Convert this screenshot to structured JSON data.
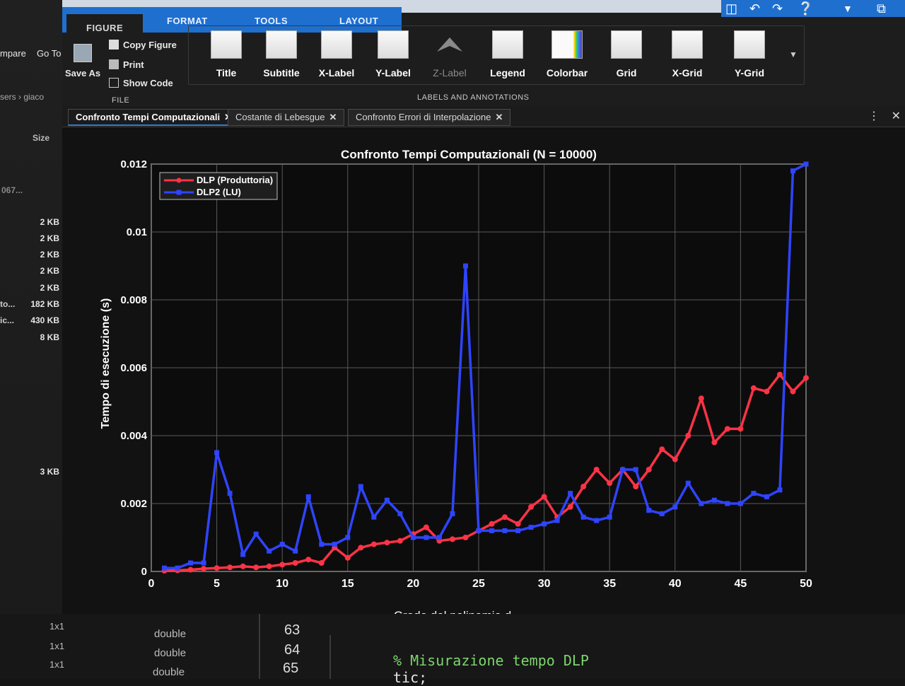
{
  "ribbon": {
    "tabs": [
      "FIGURE",
      "FORMAT",
      "TOOLS",
      "LAYOUT"
    ],
    "active_tab": "FIGURE",
    "left_buttons": {
      "compare": "mpare",
      "goto": "Go To"
    },
    "file_group": {
      "save_as": "Save As",
      "copy_figure": "Copy Figure",
      "print": "Print",
      "show_code": "Show Code",
      "label": "FILE"
    },
    "labels_group": {
      "buttons": [
        "Title",
        "Subtitle",
        "X-Label",
        "Y-Label",
        "Z-Label",
        "Legend",
        "Colorbar",
        "Grid",
        "X-Grid",
        "Y-Grid"
      ],
      "label": "LABELS AND ANNOTATIONS"
    }
  },
  "left_pane": {
    "breadcrumb": "sers › giaco",
    "size_header": "Size",
    "partial_row": "067...",
    "sizes": [
      "2 KB",
      "2 KB",
      "2 KB",
      "2 KB",
      "2 KB",
      "182 KB",
      "430 KB",
      "8 KB",
      "3 KB"
    ],
    "names": [
      "to...",
      "ic..."
    ]
  },
  "doc_tabs": [
    "Confronto Tempi Computazionali",
    "Costante di Lebesgue",
    "Confronto Errori di Interpolazione"
  ],
  "workspace_rows": [
    {
      "size": "1x1",
      "class": "double",
      "value": "63"
    },
    {
      "size": "1x1",
      "class": "double",
      "value": "64"
    },
    {
      "size": "1x1",
      "class": "double",
      "value": "65"
    }
  ],
  "code": [
    "% Misurazione tempo DLP",
    "tic;"
  ],
  "colors": {
    "series_red": "#ff3346",
    "series_blue": "#2f44ff",
    "ribbon_blue": "#1f6fcf"
  },
  "chart_data": {
    "type": "line",
    "title": "Confronto Tempi Computazionali (N = 10000)",
    "xlabel": "Grado del polinomio d",
    "ylabel": "Tempo di esecuzione (s)",
    "xlim": [
      0,
      50
    ],
    "ylim": [
      0,
      0.012
    ],
    "xticks": [
      0,
      5,
      10,
      15,
      20,
      25,
      30,
      35,
      40,
      45,
      50
    ],
    "yticks": [
      0,
      0.002,
      0.004,
      0.006,
      0.008,
      0.01,
      0.012
    ],
    "ytick_labels": [
      "0",
      "0.002",
      "0.004",
      "0.006",
      "0.008",
      "0.01",
      "0.012"
    ],
    "grid": true,
    "legend": "top-left",
    "x": [
      1,
      2,
      3,
      4,
      5,
      6,
      7,
      8,
      9,
      10,
      11,
      12,
      13,
      14,
      15,
      16,
      17,
      18,
      19,
      20,
      21,
      22,
      23,
      24,
      25,
      26,
      27,
      28,
      29,
      30,
      31,
      32,
      33,
      34,
      35,
      36,
      37,
      38,
      39,
      40,
      41,
      42,
      43,
      44,
      45,
      46,
      47,
      48,
      49,
      50
    ],
    "series": [
      {
        "name": "DLP (Produttoria)",
        "values": [
          2e-05,
          3e-05,
          5e-05,
          8e-05,
          0.0001,
          0.00012,
          0.00015,
          0.00012,
          0.00015,
          0.0002,
          0.00025,
          0.00035,
          0.00025,
          0.0007,
          0.0004,
          0.0007,
          0.0008,
          0.00085,
          0.0009,
          0.0011,
          0.0013,
          0.0009,
          0.00095,
          0.001,
          0.0012,
          0.0014,
          0.0016,
          0.0014,
          0.0019,
          0.0022,
          0.0016,
          0.0019,
          0.0025,
          0.003,
          0.0026,
          0.003,
          0.0025,
          0.003,
          0.0036,
          0.0033,
          0.004,
          0.0051,
          0.0038,
          0.0042,
          0.0042,
          0.0054,
          0.0053,
          0.0058,
          0.0053,
          0.0057
        ]
      },
      {
        "name": "DLP2 (LU)",
        "values": [
          0.0001,
          0.0001,
          0.00025,
          0.00025,
          0.0035,
          0.0023,
          0.0005,
          0.0011,
          0.0006,
          0.0008,
          0.0006,
          0.0022,
          0.0008,
          0.0008,
          0.001,
          0.0025,
          0.0016,
          0.0021,
          0.0017,
          0.001,
          0.001,
          0.001,
          0.0017,
          0.009,
          0.0012,
          0.0012,
          0.0012,
          0.0012,
          0.0013,
          0.0014,
          0.0015,
          0.0023,
          0.0016,
          0.0015,
          0.0016,
          0.003,
          0.003,
          0.0018,
          0.0017,
          0.0019,
          0.0026,
          0.002,
          0.0021,
          0.002,
          0.002,
          0.0023,
          0.0022,
          0.0024,
          0.0118,
          0.012
        ]
      }
    ]
  }
}
